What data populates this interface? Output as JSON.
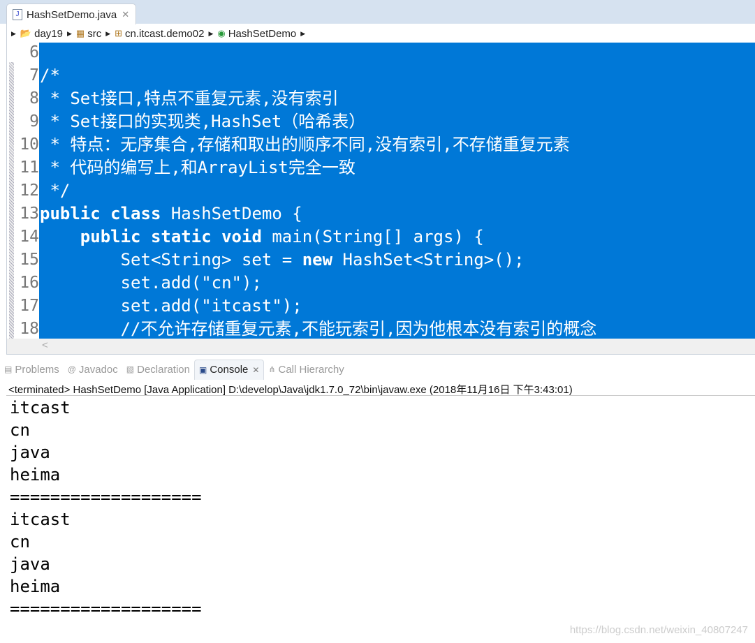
{
  "editor_tab": {
    "label": "HashSetDemo.java",
    "icon": "java-file-icon"
  },
  "breadcrumb": [
    {
      "label": "day19",
      "icon": "project-icon"
    },
    {
      "label": "src",
      "icon": "package-folder-icon"
    },
    {
      "label": "cn.itcast.demo02",
      "icon": "package-icon"
    },
    {
      "label": "HashSetDemo",
      "icon": "class-icon"
    }
  ],
  "code": [
    {
      "n": "6",
      "segs": []
    },
    {
      "n": "7",
      "segs": [
        {
          "t": "/*"
        }
      ]
    },
    {
      "n": "8",
      "segs": [
        {
          "t": " * Set接口,特点不重复元素,没有索引"
        }
      ]
    },
    {
      "n": "9",
      "segs": [
        {
          "t": " * Set接口的实现类,HashSet（哈希表）"
        }
      ]
    },
    {
      "n": "10",
      "segs": [
        {
          "t": " * 特点：无序集合,存储和取出的顺序不同,没有索引,不存储重复元素"
        }
      ]
    },
    {
      "n": "11",
      "segs": [
        {
          "t": " * 代码的编写上,和ArrayList完全一致"
        }
      ]
    },
    {
      "n": "12",
      "segs": [
        {
          "t": " */"
        }
      ]
    },
    {
      "n": "13",
      "segs": [
        {
          "t": "public",
          "b": true
        },
        {
          "t": " "
        },
        {
          "t": "class",
          "b": true
        },
        {
          "t": " HashSetDemo {"
        }
      ]
    },
    {
      "n": "14",
      "segs": [
        {
          "t": "    "
        },
        {
          "t": "public",
          "b": true
        },
        {
          "t": " "
        },
        {
          "t": "static",
          "b": true
        },
        {
          "t": " "
        },
        {
          "t": "void",
          "b": true
        },
        {
          "t": " main(String[] args) {"
        }
      ]
    },
    {
      "n": "15",
      "segs": [
        {
          "t": "        Set<String> set = "
        },
        {
          "t": "new",
          "b": true
        },
        {
          "t": " HashSet<String>();"
        }
      ]
    },
    {
      "n": "16",
      "segs": [
        {
          "t": "        set.add(\"cn\");"
        }
      ]
    },
    {
      "n": "17",
      "segs": [
        {
          "t": "        set.add(\"itcast\");"
        }
      ]
    },
    {
      "n": "18",
      "segs": [
        {
          "t": "        //不允许存储重复元素,不能玩索引,因为他根本没有索引的概念"
        }
      ]
    }
  ],
  "panel_tabs": [
    {
      "label": "Problems",
      "icon": "problems-icon",
      "active": false
    },
    {
      "label": "Javadoc",
      "icon": "at-icon",
      "active": false
    },
    {
      "label": "Declaration",
      "icon": "declaration-icon",
      "active": false
    },
    {
      "label": "Console",
      "icon": "console-icon",
      "active": true
    },
    {
      "label": "Call Hierarchy",
      "icon": "call-hierarchy-icon",
      "active": false
    }
  ],
  "console_status": "<terminated> HashSetDemo [Java Application] D:\\develop\\Java\\jdk1.7.0_72\\bin\\javaw.exe (2018年11月16日 下午3:43:01)",
  "console_output": [
    "itcast",
    "cn",
    "java",
    "heima",
    "===================",
    "itcast",
    "cn",
    "java",
    "heima",
    "==================="
  ],
  "watermark": "https://blog.csdn.net/weixin_40807247",
  "colors": {
    "selection": "#0078d7",
    "tab_bar": "#d6e2f0"
  }
}
